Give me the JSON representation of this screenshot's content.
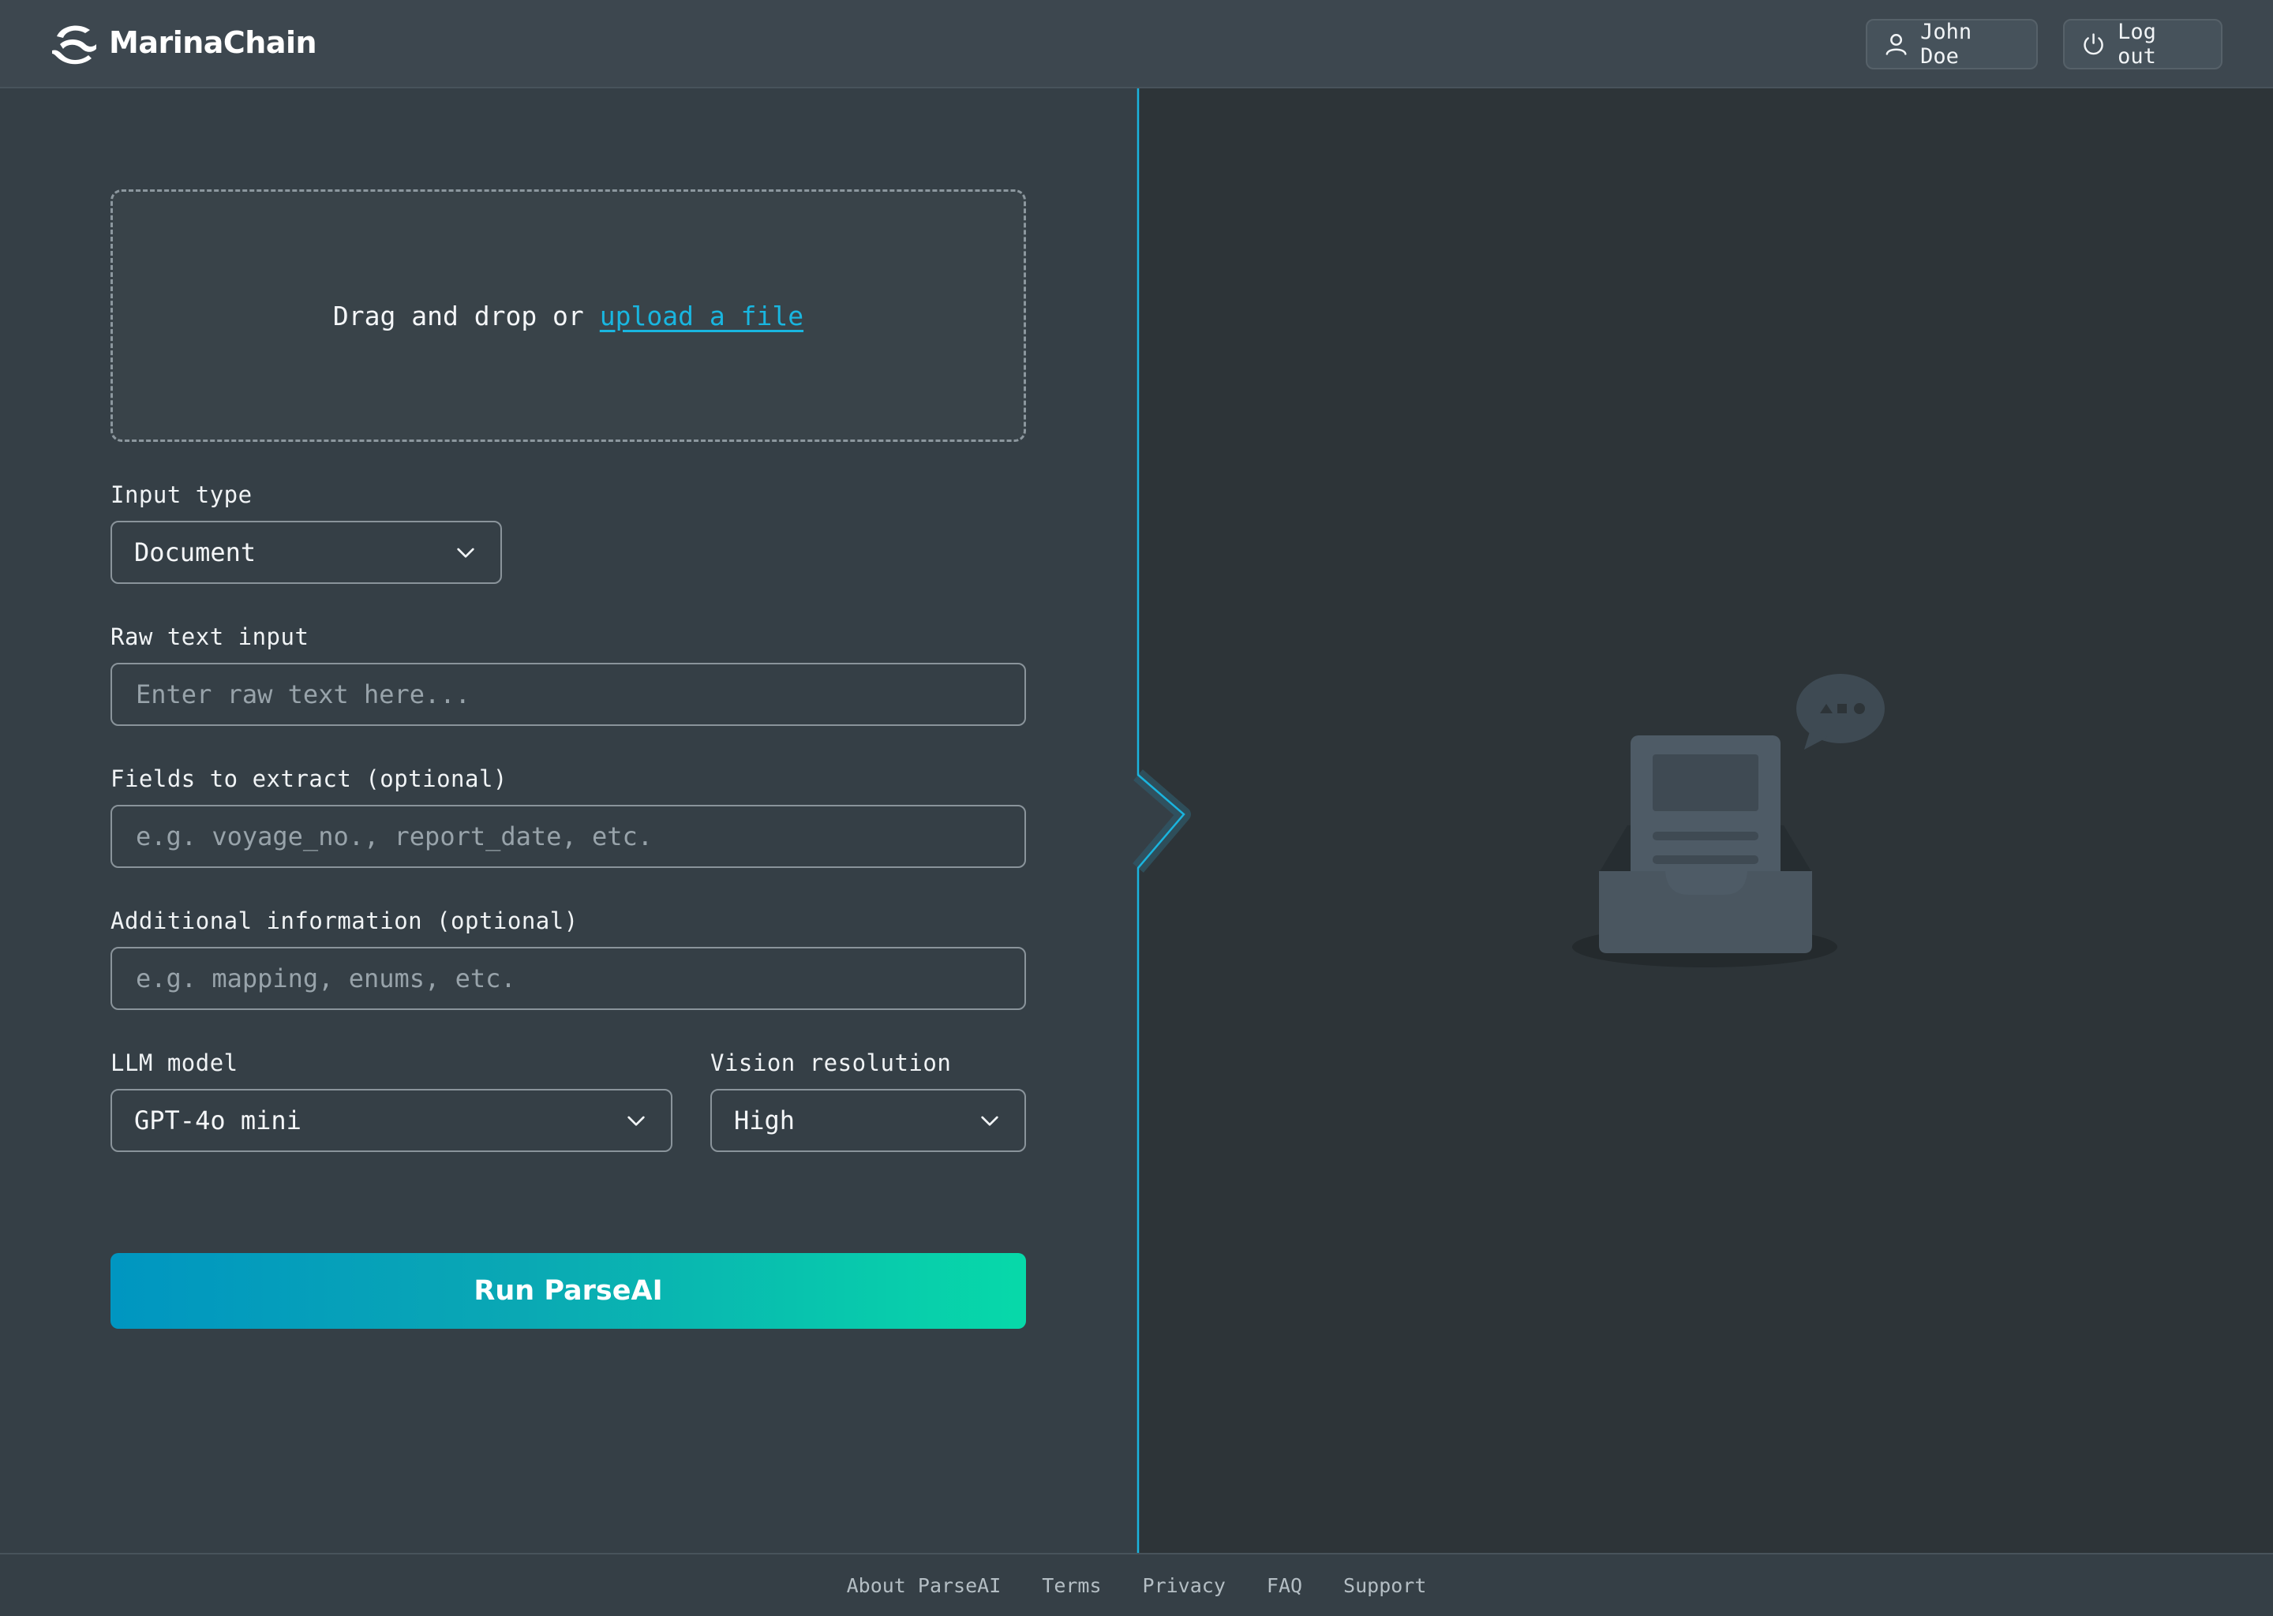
{
  "app": {
    "name": "MarinaChain"
  },
  "header": {
    "user_label": "John Doe",
    "logout_label": "Log out"
  },
  "upload": {
    "prompt": "Drag and drop or",
    "link_label": "upload a file"
  },
  "form": {
    "input_type": {
      "label": "Input type",
      "value": "Document"
    },
    "raw_text": {
      "label": "Raw text input",
      "placeholder": "Enter raw text here..."
    },
    "fields": {
      "label": "Fields to extract (optional)",
      "placeholder": "e.g. voyage_no., report_date, etc."
    },
    "additional": {
      "label": "Additional information (optional)",
      "placeholder": "e.g. mapping, enums, etc."
    },
    "llm_model": {
      "label": "LLM model",
      "value": "GPT-4o mini"
    },
    "vision_resolution": {
      "label": "Vision resolution",
      "value": "High"
    },
    "run_label": "Run ParseAI"
  },
  "footer": {
    "links": [
      "About ParseAI",
      "Terms",
      "Privacy",
      "FAQ",
      "Support"
    ]
  },
  "colors": {
    "accent": "#19b6e0",
    "button_gradient_start": "#0096c1",
    "button_gradient_end": "#07d9a9",
    "panel_left": "#353f46",
    "panel_right": "#2d3438",
    "header": "#3d474f"
  },
  "icons": {
    "logo": "wave-logo-icon",
    "user": "user-icon",
    "logout": "power-icon",
    "dropdown": "chevron-down-icon",
    "empty_state": "document-tray-illustration"
  }
}
